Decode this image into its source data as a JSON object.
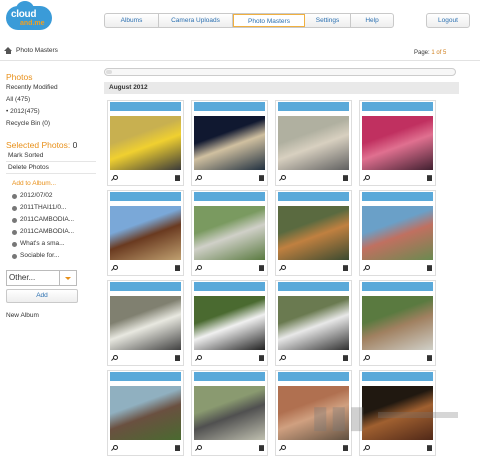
{
  "logo": {
    "line1": "cloud",
    "line2": "and.me"
  },
  "nav": {
    "tabs": [
      "Albums",
      "Camera Uploads",
      "Photo Masters",
      "Settings",
      "Help"
    ],
    "active": "Photo Masters"
  },
  "logout": "Logout",
  "breadcrumb": {
    "current": "Photo Masters"
  },
  "pagination": {
    "label": "Page:",
    "current": "1 of 5"
  },
  "sidebar": {
    "photos_heading": "Photos",
    "items": [
      "Recently Modified",
      "All (475)",
      "• 2012(475)",
      "Recycle Bin (0)"
    ],
    "selected_heading": "Selected Photos:",
    "selected_count": "0",
    "actions": [
      "Mark Sorted",
      "Delete Photos"
    ],
    "add_to_album_heading": "Add to Album...",
    "albums": [
      "2012/07/02",
      "2011THAI11/0...",
      "2011CAMBODIA...",
      "2011CAMBODIA...",
      "What's a sma...",
      "Sociable for..."
    ],
    "album_select_value": "Other...",
    "add_button": "Add",
    "new_album": "New Album"
  },
  "gallery": {
    "month_header": "August 2012",
    "photos": [
      {
        "subject": "yellow car",
        "colors": [
          "#c8b050",
          "#f0d030",
          "#3a3a3a"
        ]
      },
      {
        "subject": "night market",
        "colors": [
          "#101830",
          "#d0c0a0",
          "#203040"
        ]
      },
      {
        "subject": "exhibition hall",
        "colors": [
          "#b0b0a0",
          "#d8d0c0",
          "#606060"
        ]
      },
      {
        "subject": "pink stall",
        "colors": [
          "#c03060",
          "#e07090",
          "#402030"
        ]
      },
      {
        "subject": "temple roof",
        "colors": [
          "#7aa8d8",
          "#6a3a20",
          "#c0a070"
        ]
      },
      {
        "subject": "elephant statue",
        "colors": [
          "#7a9a60",
          "#d0d0c8",
          "#5a7a40"
        ]
      },
      {
        "subject": "tiger",
        "colors": [
          "#5a6a40",
          "#c08040",
          "#3a4a30"
        ]
      },
      {
        "subject": "zoo entrance",
        "colors": [
          "#6aa0c8",
          "#c07060",
          "#6a8a50"
        ]
      },
      {
        "subject": "panda climbing",
        "colors": [
          "#808070",
          "#e8e8e0",
          "#404040"
        ]
      },
      {
        "subject": "panda resting",
        "colors": [
          "#4a6a30",
          "#f0f0f0",
          "#202020"
        ]
      },
      {
        "subject": "panda eating",
        "colors": [
          "#6a7a50",
          "#e8e8e8",
          "#303030"
        ]
      },
      {
        "subject": "panda on log",
        "colors": [
          "#5a7a40",
          "#a08060",
          "#d0d0c8"
        ]
      },
      {
        "subject": "garden building",
        "colors": [
          "#90b0c0",
          "#6a5040",
          "#4a6a30"
        ]
      },
      {
        "subject": "stone monument",
        "colors": [
          "#8a9a70",
          "#505050",
          "#c0c0b0"
        ]
      },
      {
        "subject": "columns",
        "colors": [
          "#b07050",
          "#d0a080",
          "#605040"
        ]
      },
      {
        "subject": "dark doorway",
        "colors": [
          "#201810",
          "#a06030",
          "#502818"
        ]
      }
    ]
  }
}
